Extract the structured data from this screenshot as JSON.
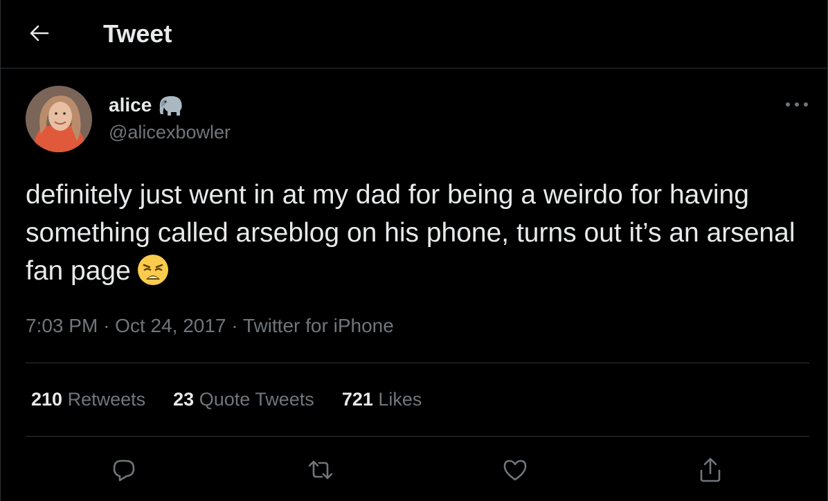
{
  "header": {
    "title": "Tweet",
    "back_icon": "arrow-left-icon"
  },
  "author": {
    "display_name": "alice",
    "badge_icon": "elephant-emoji-icon",
    "handle": "@alicexbowler"
  },
  "more_icon": "more-horizontal-icon",
  "tweet": {
    "text": "definitely just went in at my dad for being a weirdo for having something called arseblog on his phone, turns out it’s an arsenal fan page",
    "emoji_icon": "weary-face-emoji-icon"
  },
  "meta": {
    "time": "7:03 PM",
    "date": "Oct 24, 2017",
    "source": "Twitter for iPhone",
    "separator": "·"
  },
  "stats": {
    "retweets_count": "210",
    "retweets_label": "Retweets",
    "quotes_count": "23",
    "quotes_label": "Quote Tweets",
    "likes_count": "721",
    "likes_label": "Likes"
  },
  "actions": {
    "reply_icon": "reply-icon",
    "retweet_icon": "retweet-icon",
    "like_icon": "heart-icon",
    "share_icon": "share-icon"
  },
  "colors": {
    "background": "#000000",
    "text_primary": "#e7e9ea",
    "text_secondary": "#71767b",
    "divider": "#2f3336"
  }
}
